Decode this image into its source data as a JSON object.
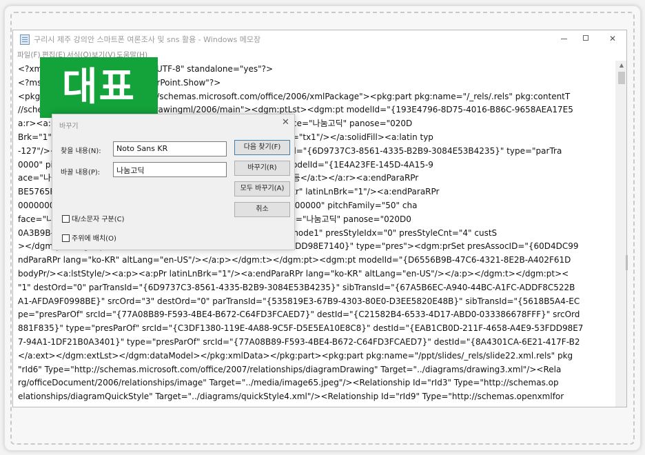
{
  "window": {
    "title": "구리시 제주 강의안 스마트폰 여론조사 및 sns 활용 - Windows 메모장",
    "menu": [
      "파일(F)",
      "편집(E)",
      "서식(O)",
      "보기(V)",
      "도움말(H)"
    ]
  },
  "badge": {
    "text": "대표",
    "color": "#14a33b"
  },
  "editor": {
    "lines": [
      "<?xml version=\"1.0\" encoding=\"UTF-8\" standalone=\"yes\"?>",
      "<?mso-application progid=\"PowerPoint.Show\"?>",
      "<pkg:package xmlns:pkg=\"http://schemas.microsoft.com/office/2006/xmlPackage\"><pkg:part pkg:name=\"/_rels/.rels\" pkg:contentT",
      "//schemas.openxmlformats.org/drawingml/2006/main\"><dgm:ptLst><dgm:pt modelId=\"{193E4796-8D75-4016-B86C-9658AEA17E5",
      "a:r><a:rPr lang=\"ko-KR\" dirty=\"0\"><a:effectLst/><a:latin typeface=\"나눔고딕\" panose=\"020D",
      "Brk=\"1\"/><a:r><a:rPr sz=\"1800\"><a:solidFill><a:schemeClr val=\"tx1\"/></a:solidFill><a:latin typ",
      "-127\"/><a:t/></a:r></a:p></dgm:t></dgm:pt><dgm:pt modelId=\"{6D9737C3-8561-4335-B2B9-3084E53B4235}\" type=\"parTra",
      "0000\" pitchFamily=\"50\"/></a:p></dgm:t></dgm:pt><dgm:pt modelId=\"{1E4A23FE-145D-4A15-9",
      "ace=\"나눔고딕\" pitchFamily=\"50\" charset=\"-127\"/></a:rPr><a:t> 등</a:t></a:r><a:endParaRPr",
      "BE5765F<dgm:t><a:bodyPr/><a:lstStyle/><a:p><a:pPr algn=\"ctr\" latinLnBrk=\"1\"/><a:endParaRPr",
      "0000000<a:latin typeface=\"나눔고딕\" panose=\"020D0604000000000000\" pitchFamily=\"50\" cha",
      "face=\"나눔고딕\" pitchFamily=\"50\" charset=\"-127\"/><a:ea typeface=\"나눔고딕\" panose=\"020D0",
      "0A3B9B-<dgm:prSet presLayoutVars=\"parentText\" presStyleLbl=\"node1\" presStyleIdx=\"0\" presStyleCnt=\"4\" custS",
      "></dgm:pt><dgm:pt modelId=\"{EAB1CB0D-211F-4658-A4E9-53FDD98E7140}\" type=\"pres\"><dgm:prSet presAssocID=\"{60D4DC99",
      "ndParaRPr lang=\"ko-KR\" altLang=\"en-US\"/></a:p></dgm:t></dgm:pt><dgm:pt modelId=\"{D6556B9B-47C6-4321-8E2B-A402F61D",
      "bodyPr/><a:lstStyle/><a:p><a:pPr latinLnBrk=\"1\"/><a:endParaRPr lang=\"ko-KR\" altLang=\"en-US\"/></a:p></dgm:t></dgm:pt><",
      "\"1\" destOrd=\"0\" parTransId=\"{6D9737C3-8561-4335-B2B9-3084E53B4235}\" sibTransId=\"{67A5B6EC-A940-44BC-A1FC-ADDF8C522B",
      "A1-AFDA9F0998BE}\" srcOrd=\"3\" destOrd=\"0\" parTransId=\"{535819E3-67B9-4303-80E0-D3EE5820E48B}\" sibTransId=\"{5618B5A4-EC",
      "pe=\"presParOf\" srcId=\"{77A08B89-F593-4BE4-B672-C64FD3FCAED7}\" destId=\"{C21582B4-6533-4D17-ABD0-033386678FFF}\" srcOrd",
      "881F835}\" type=\"presParOf\" srcId=\"{C3DF1380-119E-4A88-9C5F-D5E5EA10E8C8}\" destId=\"{EAB1CB0D-211F-4658-A4E9-53FDD98E7",
      "7-94A1-1DF21B0A3401}\" type=\"presParOf\" srcId=\"{77A08B89-F593-4BE4-B672-C64FD3FCAED7}\" destId=\"{8A4301CA-6E21-417F-B2",
      "</a:ext></dgm:extLst></dgm:dataModel></pkg:xmlData></pkg:part><pkg:part pkg:name=\"/ppt/slides/_rels/slide22.xml.rels\" pkg",
      "\"rId6\" Type=\"http://schemas.microsoft.com/office/2007/relationships/diagramDrawing\" Target=\"../diagrams/drawing3.xml\"/><Rela",
      "rg/officeDocument/2006/relationships/image\" Target=\"../media/image65.jpeg\"/><Relationship Id=\"rId3\" Type=\"http://schemas.op",
      "elationships/diagramQuickStyle\" Target=\"../diagrams/quickStyle4.xml\"/><Relationship Id=\"rId9\" Type=\"http://schemas.openxmlfor"
    ]
  },
  "dialog": {
    "title": "바꾸기",
    "find_label": "찾을 내용(N):",
    "find_value": "Noto Sans KR",
    "replace_label": "바꿀 내용(P):",
    "replace_value": "나눔고딕",
    "buttons": {
      "find_next": "다음 찾기(F)",
      "replace": "바꾸기(R)",
      "replace_all": "모두 바꾸기(A)",
      "cancel": "취소"
    },
    "match_case": "대/소문자 구분(C)",
    "wrap_around": "주위에 배치(O)"
  }
}
